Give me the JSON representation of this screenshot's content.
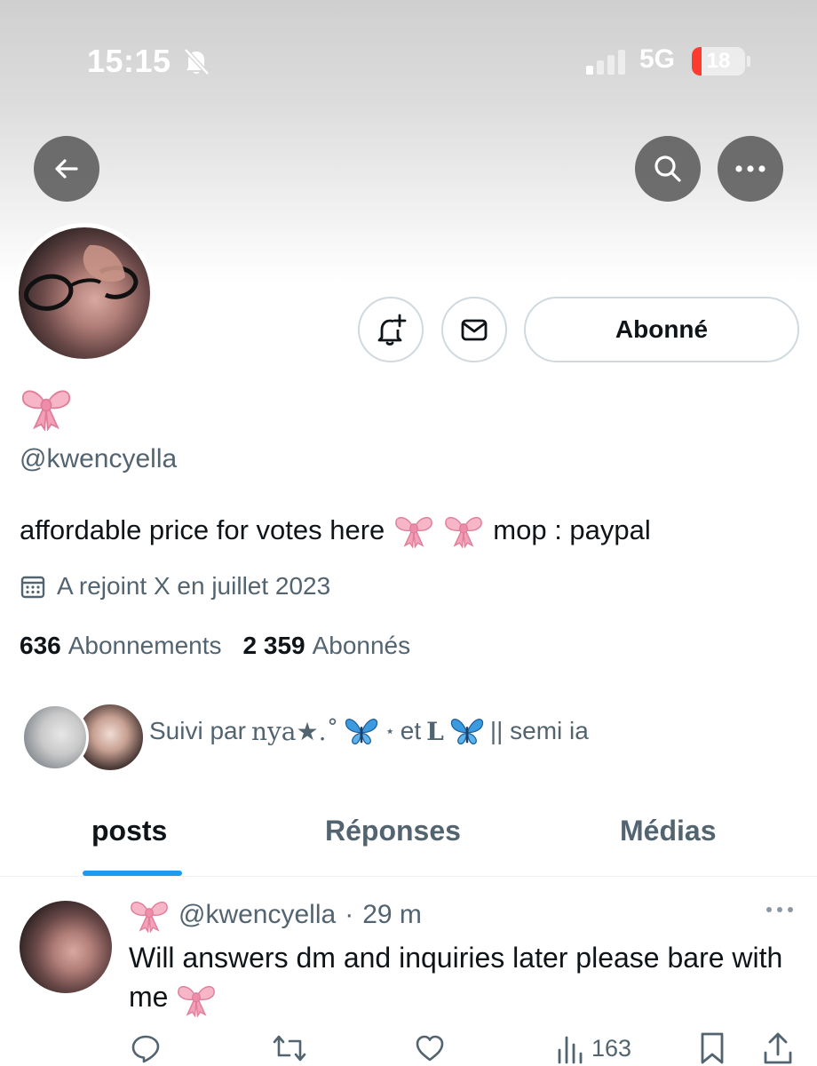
{
  "status_bar": {
    "time": "15:15",
    "network": "5G",
    "battery_level": "18",
    "battery_fraction": 0.18,
    "battery_color": "#ff3b30"
  },
  "header": {
    "back_icon": "arrow-left-icon",
    "search_icon": "search-icon",
    "more_icon": "more-horizontal-icon"
  },
  "profile": {
    "display_name_emoji": "🎀",
    "handle": "@kwencyella",
    "bio_text_1": "affordable price for votes here",
    "bio_text_2": "mop : paypal",
    "joined": "A rejoint X en juillet 2023",
    "following_count": "636",
    "following_label": "Abonnements",
    "followers_count": "2 359",
    "followers_label": "Abonnés",
    "follow_button_label": "Abonné"
  },
  "followed_by": {
    "prefix": "Suivi par",
    "name1": "nya★.˚",
    "connector": "et",
    "name2": "L",
    "suffix": "|| semi ia"
  },
  "tabs": [
    {
      "label": "posts",
      "active": true
    },
    {
      "label": "Réponses",
      "active": false
    },
    {
      "label": "Médias",
      "active": false
    }
  ],
  "tweet": {
    "handle": "@kwencyella",
    "separator": "·",
    "time": "29 m",
    "text": "Will answers dm and inquiries later please bare with me",
    "views": "163"
  },
  "colors": {
    "accent": "#1d9bf0",
    "secondary_text": "#536471",
    "primary_text": "#0f1419",
    "bow": "#f4a6bd"
  }
}
